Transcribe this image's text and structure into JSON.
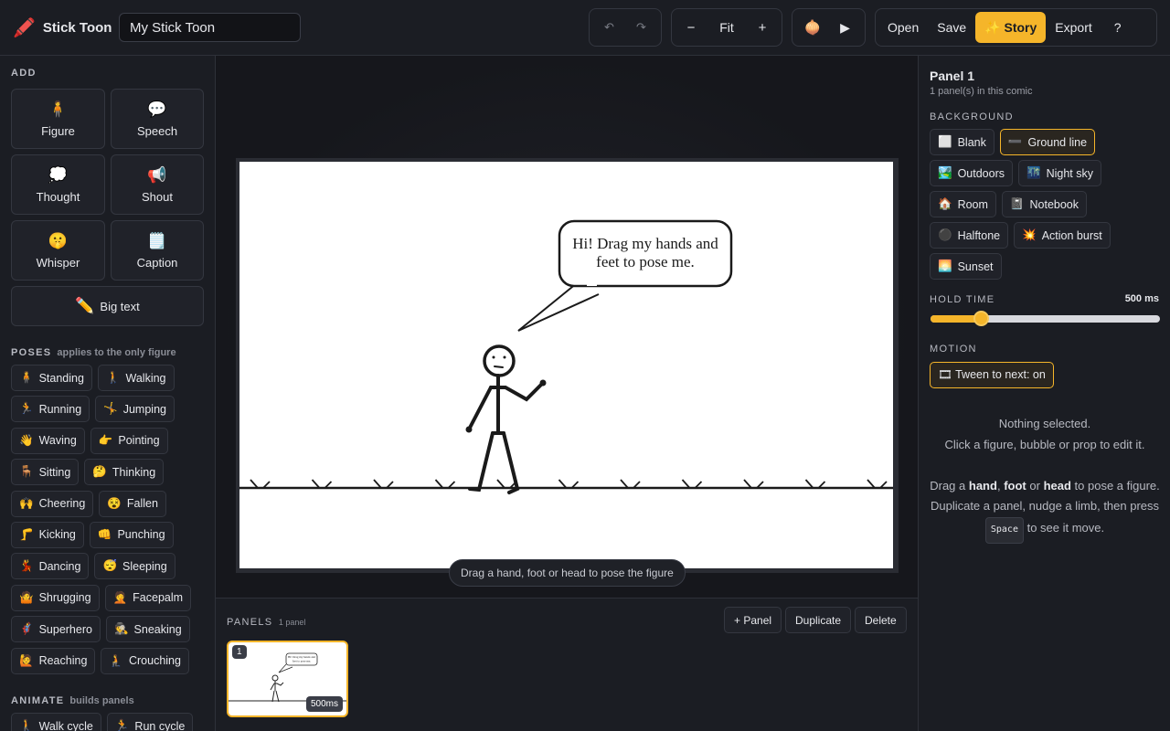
{
  "app": {
    "name": "Stick Toon",
    "logo_icon": "🖍️",
    "doc_title": "My Stick Toon"
  },
  "toolbar": {
    "undo": "↶",
    "redo": "↷",
    "zoom_out": "−",
    "zoom_fit": "Fit",
    "zoom_in": "+",
    "onion_icon": "🧅",
    "play_icon": "▶",
    "open": "Open",
    "save": "Save",
    "story": "✨ Story",
    "export": "Export",
    "help": "?"
  },
  "left": {
    "add_title": "ADD",
    "add_items": [
      {
        "icon": "🧍",
        "label": "Figure"
      },
      {
        "icon": "💬",
        "label": "Speech"
      },
      {
        "icon": "💭",
        "label": "Thought"
      },
      {
        "icon": "📢",
        "label": "Shout"
      },
      {
        "icon": "🤫",
        "label": "Whisper"
      },
      {
        "icon": "🗒️",
        "label": "Caption"
      }
    ],
    "big_text": {
      "icon": "✏️",
      "label": "Big text"
    },
    "poses_title": "POSES",
    "poses_sub": "applies to the only figure",
    "poses": [
      {
        "icon": "🧍",
        "label": "Standing"
      },
      {
        "icon": "🚶",
        "label": "Walking"
      },
      {
        "icon": "🏃",
        "label": "Running"
      },
      {
        "icon": "🤸",
        "label": "Jumping"
      },
      {
        "icon": "👋",
        "label": "Waving"
      },
      {
        "icon": "👉",
        "label": "Pointing"
      },
      {
        "icon": "🪑",
        "label": "Sitting"
      },
      {
        "icon": "🤔",
        "label": "Thinking"
      },
      {
        "icon": "🙌",
        "label": "Cheering"
      },
      {
        "icon": "😵",
        "label": "Fallen"
      },
      {
        "icon": "🦵",
        "label": "Kicking"
      },
      {
        "icon": "👊",
        "label": "Punching"
      },
      {
        "icon": "💃",
        "label": "Dancing"
      },
      {
        "icon": "😴",
        "label": "Sleeping"
      },
      {
        "icon": "🤷",
        "label": "Shrugging"
      },
      {
        "icon": "🤦",
        "label": "Facepalm"
      },
      {
        "icon": "🦸",
        "label": "Superhero"
      },
      {
        "icon": "🕵️",
        "label": "Sneaking"
      },
      {
        "icon": "🙋",
        "label": "Reaching"
      },
      {
        "icon": "🧎",
        "label": "Crouching"
      }
    ],
    "animate_title": "ANIMATE",
    "animate_sub": "builds panels",
    "animate": [
      {
        "icon": "🚶",
        "label": "Walk cycle"
      },
      {
        "icon": "🏃",
        "label": "Run cycle"
      }
    ]
  },
  "canvas": {
    "speech": [
      "Hi! Drag my hands and",
      "feet to pose me."
    ],
    "hint": "Drag a hand, foot or head to pose the figure"
  },
  "panels": {
    "title": "PANELS",
    "count": "1 panel",
    "add": "+ Panel",
    "duplicate": "Duplicate",
    "delete": "Delete",
    "thumb_num": "1",
    "thumb_ms": "500ms",
    "thumb_speech": [
      "Hi! Drag my hands and",
      "feet to pose me."
    ]
  },
  "right": {
    "panel_title": "Panel 1",
    "panel_sub": "1 panel(s) in this comic",
    "bg_title": "BACKGROUND",
    "backgrounds": [
      {
        "icon": "⬜",
        "label": "Blank",
        "active": false
      },
      {
        "icon": "➖",
        "label": "Ground line",
        "active": true
      },
      {
        "icon": "🏞️",
        "label": "Outdoors",
        "active": false
      },
      {
        "icon": "🌃",
        "label": "Night sky",
        "active": false
      },
      {
        "icon": "🏠",
        "label": "Room",
        "active": false
      },
      {
        "icon": "📓",
        "label": "Notebook",
        "active": false
      },
      {
        "icon": "⚫",
        "label": "Halftone",
        "active": false
      },
      {
        "icon": "💥",
        "label": "Action burst",
        "active": false
      },
      {
        "icon": "🌅",
        "label": "Sunset",
        "active": false
      }
    ],
    "hold_title": "HOLD TIME",
    "hold_value": "500 ms",
    "hold_fraction": 0.22,
    "motion_title": "MOTION",
    "tween": "🎞 Tween to next: on",
    "nothing_1": "Nothing selected.",
    "nothing_2": "Click a figure, bubble or prop to edit it.",
    "drag_a": "Drag a",
    "hand": "hand",
    "comma": ",",
    "foot": "foot",
    "or": "or",
    "head": "head",
    "to_pose": "to pose a figure.",
    "dup_text": "Duplicate a panel, nudge a limb, then press",
    "space_key": "Space",
    "see_move": "to see it move."
  },
  "colors": {
    "accent": "#f5b52a",
    "panel_bg": "#1b1d23",
    "canvas_bg": "#121317"
  }
}
